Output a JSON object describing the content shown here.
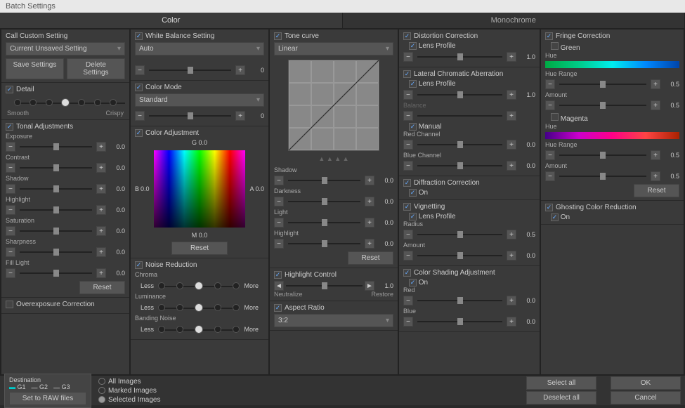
{
  "window_title": "Batch Settings",
  "tabs": {
    "color": "Color",
    "monochrome": "Monochrome"
  },
  "col1": {
    "custom": {
      "title": "Call Custom Setting",
      "dropdown": "Current Unsaved Setting",
      "save": "Save Settings",
      "delete": "Delete Settings"
    },
    "detail": {
      "title": "Detail",
      "left": "Smooth",
      "right": "Crispy"
    },
    "tonal": {
      "title": "Tonal Adjustments",
      "exposure": {
        "label": "Exposure",
        "value": "0.0"
      },
      "contrast": {
        "label": "Contrast",
        "value": "0.0"
      },
      "shadow": {
        "label": "Shadow",
        "value": "0.0"
      },
      "highlight": {
        "label": "Highlight",
        "value": "0.0"
      },
      "saturation": {
        "label": "Saturation",
        "value": "0.0"
      },
      "sharpness": {
        "label": "Sharpness",
        "value": "0.0"
      },
      "filllight": {
        "label": "Fill Light",
        "value": "0.0"
      },
      "reset": "Reset"
    },
    "overexposure": "Overexposure Correction"
  },
  "col2": {
    "wb": {
      "title": "White Balance Setting",
      "dropdown": "Auto",
      "value": "0"
    },
    "colormode": {
      "title": "Color Mode",
      "dropdown": "Standard",
      "value": "0"
    },
    "coloradj": {
      "title": "Color Adjustment",
      "g": "G 0.0",
      "b": "B",
      "a": "A",
      "m": "M 0.0",
      "zero": "0.0",
      "reset": "Reset"
    },
    "noise": {
      "title": "Noise Reduction",
      "chroma": "Chroma",
      "luminance": "Luminance",
      "banding": "Banding Noise",
      "less": "Less",
      "more": "More"
    }
  },
  "col3": {
    "tone": {
      "title": "Tone curve",
      "dropdown": "Linear",
      "shadow": {
        "label": "Shadow",
        "value": "0.0"
      },
      "darkness": {
        "label": "Darkness",
        "value": "0.0"
      },
      "light": {
        "label": "Light",
        "value": "0.0"
      },
      "highlight": {
        "label": "Highlight",
        "value": "0.0"
      },
      "reset": "Reset"
    },
    "hlcontrol": {
      "title": "Highlight Control",
      "neutralize": "Neutralize",
      "restore": "Restore",
      "value": "1.0"
    },
    "aspect": {
      "title": "Aspect Ratio",
      "dropdown": "3:2"
    }
  },
  "col4": {
    "distortion": {
      "title": "Distortion Correction",
      "lens": "Lens Profile",
      "value": "1.0"
    },
    "lateral": {
      "title": "Lateral Chromatic Aberration",
      "lens": "Lens Profile",
      "lensval": "1.0",
      "balance": "Balance",
      "manual": "Manual",
      "red": "Red Channel",
      "redval": "0.0",
      "blue": "Blue Channel",
      "blueval": "0.0"
    },
    "diffraction": {
      "title": "Diffraction Correction",
      "on": "On"
    },
    "vignetting": {
      "title": "Vignetting",
      "lens": "Lens Profile",
      "radius": "Radius",
      "radiusval": "0.5",
      "amount": "Amount",
      "amountval": "0.0"
    },
    "shading": {
      "title": "Color Shading Adjustment",
      "on": "On",
      "red": "Red",
      "redval": "0.0",
      "blue": "Blue",
      "blueval": "0.0"
    }
  },
  "col5": {
    "fringe": {
      "title": "Fringe Correction",
      "green": "Green",
      "hue": "Hue",
      "huerange": "Hue Range",
      "huerangeval": "0.5",
      "amount": "Amount",
      "amountval": "0.5",
      "magenta": "Magenta",
      "reset": "Reset"
    },
    "ghosting": {
      "title": "Ghosting Color Reduction",
      "on": "On"
    }
  },
  "footer": {
    "destination": "Destination",
    "g1": "G1",
    "g2": "G2",
    "g3": "G3",
    "raw": "Set to RAW files",
    "all": "All Images",
    "marked": "Marked Images",
    "selected": "Selected Images",
    "selectall": "Select all",
    "deselectall": "Deselect all",
    "ok": "OK",
    "cancel": "Cancel"
  }
}
